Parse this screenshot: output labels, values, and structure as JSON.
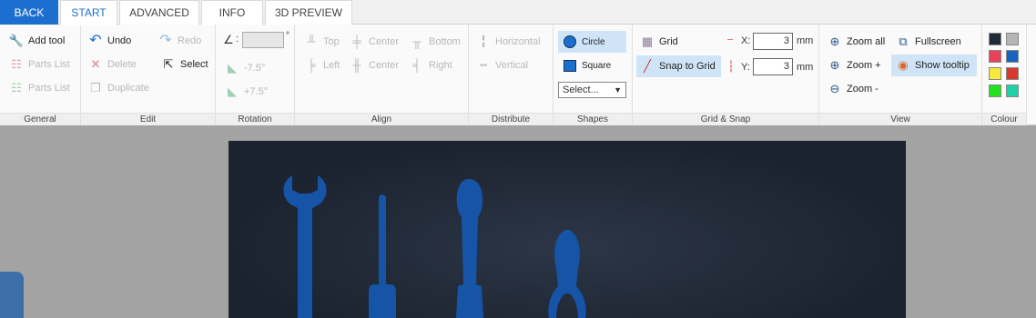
{
  "tabs": {
    "back": "BACK",
    "start": "START",
    "advanced": "ADVANCED",
    "info": "INFO",
    "preview": "3D PREVIEW"
  },
  "general": {
    "add_tool": "Add tool",
    "parts_list_1": "Parts List",
    "parts_list_2": "Parts List",
    "label": "General"
  },
  "edit": {
    "undo": "Undo",
    "redo": "Redo",
    "delete": "Delete",
    "select": "Select",
    "duplicate": "Duplicate",
    "label": "Edit"
  },
  "rotation": {
    "angle_prefix": ":",
    "degree_sign": "°",
    "minus": "-7.5°",
    "plus": "+7.5°",
    "label": "Rotation"
  },
  "align": {
    "top": "Top",
    "center_h": "Center",
    "bottom": "Bottom",
    "left": "Left",
    "center_v": "Center",
    "right": "Right",
    "label": "Align"
  },
  "distribute": {
    "horizontal": "Horizontal",
    "vertical": "Vertical",
    "label": "Distribute"
  },
  "shapes": {
    "circle": "Circle",
    "square": "Square",
    "select_value": "Select...",
    "label": "Shapes"
  },
  "grid": {
    "grid": "Grid",
    "snap": "Snap to Grid",
    "x_label": "X:",
    "y_label": "Y:",
    "x_value": "3",
    "y_value": "3",
    "unit_x": "mm",
    "unit_y": "mm",
    "label": "Grid & Snap"
  },
  "view": {
    "zoom_all": "Zoom all",
    "fullscreen": "Fullscreen",
    "zoom_in": "Zoom +",
    "show_tooltip": "Show tooltip",
    "zoom_out": "Zoom -",
    "label": "View"
  },
  "colour": {
    "label": "Colour",
    "swatches": [
      "#1e2a38",
      "#b5b5b5",
      "#e8415b",
      "#1565c0",
      "#f5ea3c",
      "#d63a2a",
      "#22e022",
      "#1fd0a8"
    ]
  },
  "accent": "#1c6fd0",
  "tool_color": "#1654a8"
}
